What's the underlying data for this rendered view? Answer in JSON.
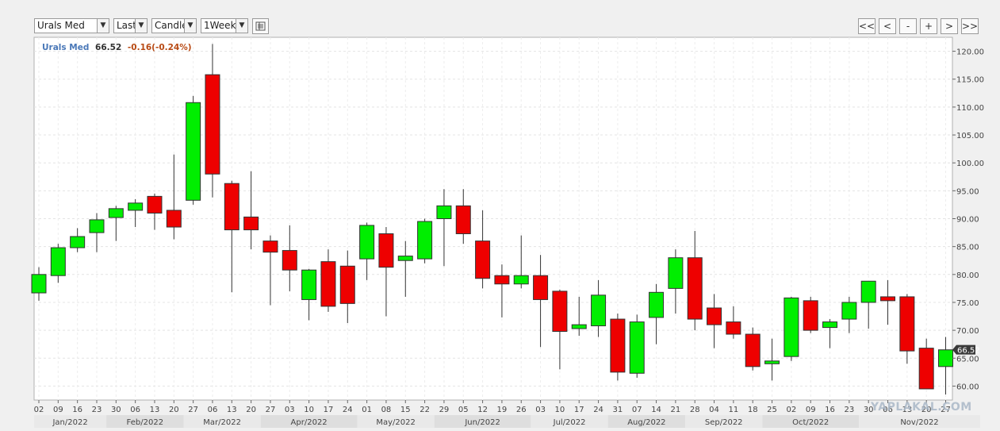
{
  "toolbar": {
    "symbol_select": "Urals Med",
    "price_type_select": "Last",
    "chart_type_select": "Candle",
    "period_select": "1Week",
    "nav_buttons": [
      "<<",
      "<",
      "-",
      "+",
      ">",
      ">>"
    ]
  },
  "legend": {
    "symbol": "Urals Med",
    "last": "66.52",
    "change": "-0.16(-0.24%)"
  },
  "watermark": "YAPLAKAL.COM",
  "colors": {
    "up": "#00ee00",
    "down": "#ee0000",
    "symbol": "#4a78b8",
    "change": "#b84a14"
  },
  "chart_data": {
    "type": "candlestick",
    "title": "",
    "xlabel": "",
    "ylabel": "",
    "ylim": [
      57.5,
      122.5
    ],
    "yticks": [
      "60.00",
      "65.00",
      "70.00",
      "75.00",
      "80.00",
      "85.00",
      "90.00",
      "95.00",
      "100.00",
      "105.00",
      "110.00",
      "115.00",
      "120.00"
    ],
    "last_price_tag": "66.52",
    "x_ticks": [
      "02",
      "09",
      "16",
      "23",
      "30",
      "06",
      "13",
      "20",
      "27",
      "06",
      "13",
      "20",
      "27",
      "03",
      "10",
      "17",
      "24",
      "01",
      "08",
      "15",
      "22",
      "29",
      "05",
      "12",
      "19",
      "26",
      "03",
      "10",
      "17",
      "24",
      "31",
      "07",
      "14",
      "21",
      "28",
      "04",
      "11",
      "18",
      "25",
      "02",
      "09",
      "16",
      "23",
      "30",
      "06",
      "13",
      "20",
      "27"
    ],
    "months": [
      {
        "label": "Jan/2022",
        "start": 0
      },
      {
        "label": "Feb/2022",
        "start": 4
      },
      {
        "label": "Mar/2022",
        "start": 8
      },
      {
        "label": "Apr/2022",
        "start": 12
      },
      {
        "label": "May/2022",
        "start": 17
      },
      {
        "label": "Jun/2022",
        "start": 21
      },
      {
        "label": "Jul/2022",
        "start": 26
      },
      {
        "label": "Aug/2022",
        "start": 30
      },
      {
        "label": "Sep/2022",
        "start": 34
      },
      {
        "label": "Oct/2022",
        "start": 38
      },
      {
        "label": "Nov/2022",
        "start": 43
      }
    ],
    "candles": [
      {
        "o": 76.7,
        "h": 81.3,
        "l": 75.3,
        "c": 80.0
      },
      {
        "o": 79.8,
        "h": 85.5,
        "l": 78.5,
        "c": 84.8
      },
      {
        "o": 84.8,
        "h": 88.3,
        "l": 84.0,
        "c": 86.8
      },
      {
        "o": 87.5,
        "h": 91.0,
        "l": 84.0,
        "c": 89.8
      },
      {
        "o": 90.2,
        "h": 92.3,
        "l": 86.0,
        "c": 91.8
      },
      {
        "o": 91.5,
        "h": 93.5,
        "l": 88.5,
        "c": 92.8
      },
      {
        "o": 94.0,
        "h": 94.5,
        "l": 88.0,
        "c": 91.0
      },
      {
        "o": 91.5,
        "h": 101.5,
        "l": 86.3,
        "c": 88.5
      },
      {
        "o": 93.3,
        "h": 112.0,
        "l": 92.5,
        "c": 110.8
      },
      {
        "o": 115.8,
        "h": 121.3,
        "l": 93.8,
        "c": 98.0
      },
      {
        "o": 96.3,
        "h": 96.8,
        "l": 76.8,
        "c": 88.0
      },
      {
        "o": 90.3,
        "h": 98.5,
        "l": 84.5,
        "c": 88.0
      },
      {
        "o": 86.0,
        "h": 87.0,
        "l": 74.5,
        "c": 84.0
      },
      {
        "o": 84.3,
        "h": 88.8,
        "l": 77.0,
        "c": 80.8
      },
      {
        "o": 75.5,
        "h": 81.0,
        "l": 71.8,
        "c": 80.8
      },
      {
        "o": 82.3,
        "h": 84.5,
        "l": 73.3,
        "c": 74.3
      },
      {
        "o": 81.5,
        "h": 84.3,
        "l": 71.3,
        "c": 74.8
      },
      {
        "o": 82.8,
        "h": 89.3,
        "l": 79.0,
        "c": 88.8
      },
      {
        "o": 87.3,
        "h": 88.5,
        "l": 72.5,
        "c": 81.3
      },
      {
        "o": 82.5,
        "h": 86.0,
        "l": 76.0,
        "c": 83.3
      },
      {
        "o": 82.8,
        "h": 90.0,
        "l": 82.0,
        "c": 89.5
      },
      {
        "o": 90.0,
        "h": 95.3,
        "l": 81.5,
        "c": 92.3
      },
      {
        "o": 92.3,
        "h": 95.3,
        "l": 85.5,
        "c": 87.3
      },
      {
        "o": 86.0,
        "h": 91.5,
        "l": 77.5,
        "c": 79.3
      },
      {
        "o": 79.8,
        "h": 81.8,
        "l": 72.3,
        "c": 78.3
      },
      {
        "o": 78.3,
        "h": 87.0,
        "l": 77.5,
        "c": 79.8
      },
      {
        "o": 79.8,
        "h": 83.5,
        "l": 67.0,
        "c": 75.5
      },
      {
        "o": 77.0,
        "h": 77.3,
        "l": 63.0,
        "c": 69.8
      },
      {
        "o": 70.3,
        "h": 76.0,
        "l": 69.0,
        "c": 71.0
      },
      {
        "o": 70.8,
        "h": 79.0,
        "l": 68.8,
        "c": 76.3
      },
      {
        "o": 72.0,
        "h": 73.0,
        "l": 61.0,
        "c": 62.5
      },
      {
        "o": 62.3,
        "h": 72.8,
        "l": 61.5,
        "c": 71.5
      },
      {
        "o": 72.3,
        "h": 78.3,
        "l": 67.5,
        "c": 76.8
      },
      {
        "o": 77.5,
        "h": 84.5,
        "l": 73.0,
        "c": 83.0
      },
      {
        "o": 83.0,
        "h": 87.8,
        "l": 70.0,
        "c": 72.0
      },
      {
        "o": 74.0,
        "h": 76.5,
        "l": 66.8,
        "c": 71.0
      },
      {
        "o": 71.5,
        "h": 74.3,
        "l": 68.5,
        "c": 69.3
      },
      {
        "o": 69.3,
        "h": 70.5,
        "l": 62.8,
        "c": 63.5
      },
      {
        "o": 64.0,
        "h": 68.5,
        "l": 61.0,
        "c": 64.5
      },
      {
        "o": 65.3,
        "h": 76.0,
        "l": 64.5,
        "c": 75.8
      },
      {
        "o": 75.3,
        "h": 76.0,
        "l": 69.5,
        "c": 70.0
      },
      {
        "o": 70.5,
        "h": 72.0,
        "l": 66.8,
        "c": 71.5
      },
      {
        "o": 72.0,
        "h": 76.0,
        "l": 69.5,
        "c": 75.0
      },
      {
        "o": 75.0,
        "h": 78.8,
        "l": 70.3,
        "c": 78.8
      },
      {
        "o": 76.0,
        "h": 79.0,
        "l": 71.0,
        "c": 75.3
      },
      {
        "o": 76.0,
        "h": 76.5,
        "l": 64.0,
        "c": 66.3
      },
      {
        "o": 66.8,
        "h": 68.5,
        "l": 59.5,
        "c": 59.5
      },
      {
        "o": 63.5,
        "h": 68.8,
        "l": 58.5,
        "c": 66.5
      }
    ]
  }
}
